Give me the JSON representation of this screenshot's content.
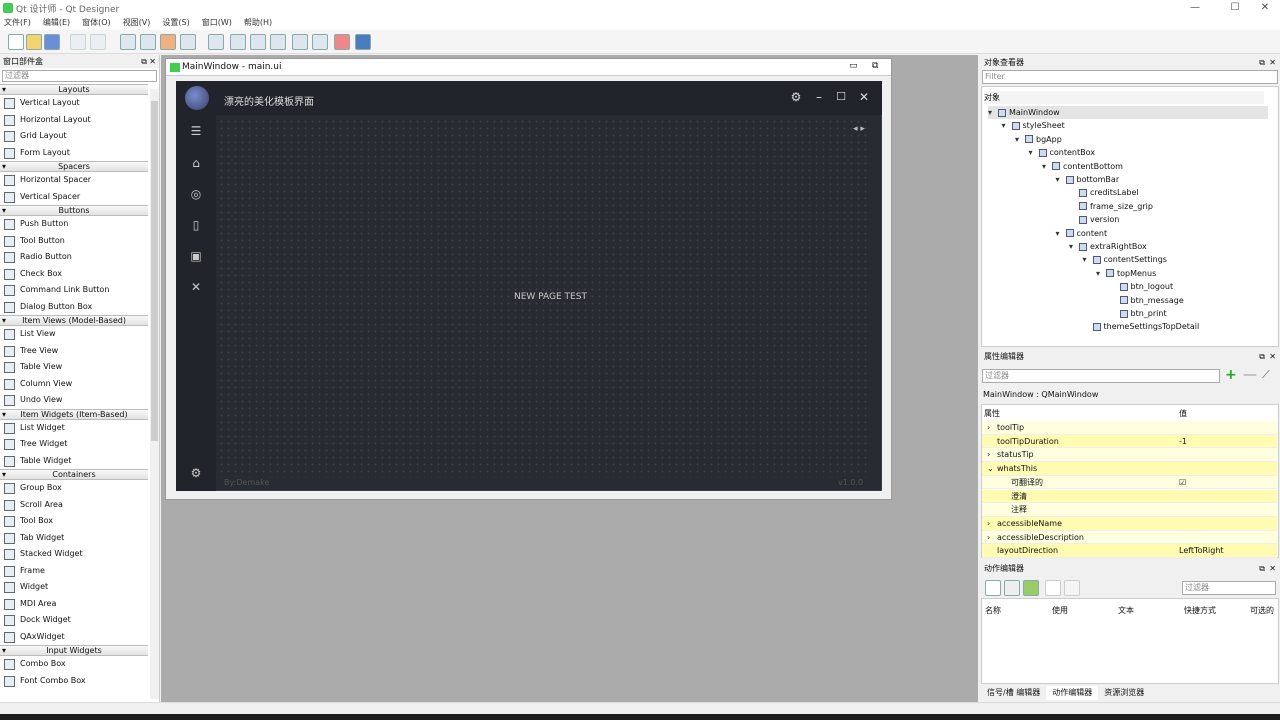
{
  "window": {
    "title": "Qt 设计师 - Qt Designer",
    "min": "—",
    "max": "☐",
    "close": "✕"
  },
  "menu": [
    "文件(F)",
    "编辑(E)",
    "窗体(O)",
    "视图(V)",
    "设置(S)",
    "窗口(W)",
    "帮助(H)"
  ],
  "widget_box": {
    "title": "窗口部件盒",
    "filter_placeholder": "过滤器",
    "categories": [
      {
        "name": "Layouts",
        "items": [
          "Vertical Layout",
          "Horizontal Layout",
          "Grid Layout",
          "Form Layout"
        ]
      },
      {
        "name": "Spacers",
        "items": [
          "Horizontal Spacer",
          "Vertical Spacer"
        ]
      },
      {
        "name": "Buttons",
        "items": [
          "Push Button",
          "Tool Button",
          "Radio Button",
          "Check Box",
          "Command Link Button",
          "Dialog Button Box"
        ]
      },
      {
        "name": "Item Views (Model-Based)",
        "items": [
          "List View",
          "Tree View",
          "Table View",
          "Column View",
          "Undo View"
        ]
      },
      {
        "name": "Item Widgets (Item-Based)",
        "items": [
          "List Widget",
          "Tree Widget",
          "Table Widget"
        ]
      },
      {
        "name": "Containers",
        "items": [
          "Group Box",
          "Scroll Area",
          "Tool Box",
          "Tab Widget",
          "Stacked Widget",
          "Frame",
          "Widget",
          "MDI Area",
          "Dock Widget",
          "QAxWidget"
        ]
      },
      {
        "name": "Input Widgets",
        "items": [
          "Combo Box",
          "Font Combo Box"
        ]
      }
    ]
  },
  "form": {
    "title": "MainWindow - main.ui"
  },
  "app": {
    "title": "漂亮的美化模板界面",
    "center_text": "NEW PAGE TEST",
    "credits": "By:Demake",
    "version": "v1.0.0"
  },
  "object_inspector": {
    "title": "对象查看器",
    "filter_placeholder": "Filter",
    "column": "对象",
    "tree": [
      {
        "label": "MainWindow",
        "depth": 0,
        "arrow": "▾"
      },
      {
        "label": "styleSheet",
        "depth": 1,
        "arrow": "▾"
      },
      {
        "label": "bgApp",
        "depth": 2,
        "arrow": "▾"
      },
      {
        "label": "contentBox",
        "depth": 3,
        "arrow": "▾"
      },
      {
        "label": "contentBottom",
        "depth": 4,
        "arrow": "▾"
      },
      {
        "label": "bottomBar",
        "depth": 5,
        "arrow": "▾"
      },
      {
        "label": "creditsLabel",
        "depth": 6,
        "arrow": ""
      },
      {
        "label": "frame_size_grip",
        "depth": 6,
        "arrow": ""
      },
      {
        "label": "version",
        "depth": 6,
        "arrow": ""
      },
      {
        "label": "content",
        "depth": 5,
        "arrow": "▾"
      },
      {
        "label": "extraRightBox",
        "depth": 6,
        "arrow": "▾"
      },
      {
        "label": "contentSettings",
        "depth": 7,
        "arrow": "▾"
      },
      {
        "label": "topMenus",
        "depth": 8,
        "arrow": "▾"
      },
      {
        "label": "btn_logout",
        "depth": 9,
        "arrow": ""
      },
      {
        "label": "btn_message",
        "depth": 9,
        "arrow": ""
      },
      {
        "label": "btn_print",
        "depth": 9,
        "arrow": ""
      },
      {
        "label": "themeSettingsTopDetail",
        "depth": 7,
        "arrow": ""
      }
    ]
  },
  "property_editor": {
    "title": "属性编辑器",
    "filter_placeholder": "过滤器",
    "object": "MainWindow : QMainWindow",
    "col_prop": "属性",
    "col_value": "值",
    "rows": [
      {
        "name": "toolTip",
        "value": "",
        "arrow": "›"
      },
      {
        "name": "toolTipDuration",
        "value": "-1",
        "arrow": ""
      },
      {
        "name": "statusTip",
        "value": "",
        "arrow": "›"
      },
      {
        "name": "whatsThis",
        "value": "",
        "arrow": "⌄"
      },
      {
        "name": "可翻译的",
        "value": "☑",
        "arrow": "",
        "sub": true
      },
      {
        "name": "澄清",
        "value": "",
        "arrow": "",
        "sub": true
      },
      {
        "name": "注释",
        "value": "",
        "arrow": "",
        "sub": true
      },
      {
        "name": "accessibleName",
        "value": "",
        "arrow": "›"
      },
      {
        "name": "accessibleDescription",
        "value": "",
        "arrow": "›"
      },
      {
        "name": "layoutDirection",
        "value": "LeftToRight",
        "arrow": ""
      }
    ]
  },
  "action_editor": {
    "title": "动作编辑器",
    "filter_placeholder": "过滤器",
    "columns": [
      "名称",
      "使用",
      "文本",
      "快捷方式",
      "可选的"
    ]
  },
  "bottom_tabs": [
    "信号/槽 编辑器",
    "动作编辑器",
    "资源浏览器"
  ]
}
